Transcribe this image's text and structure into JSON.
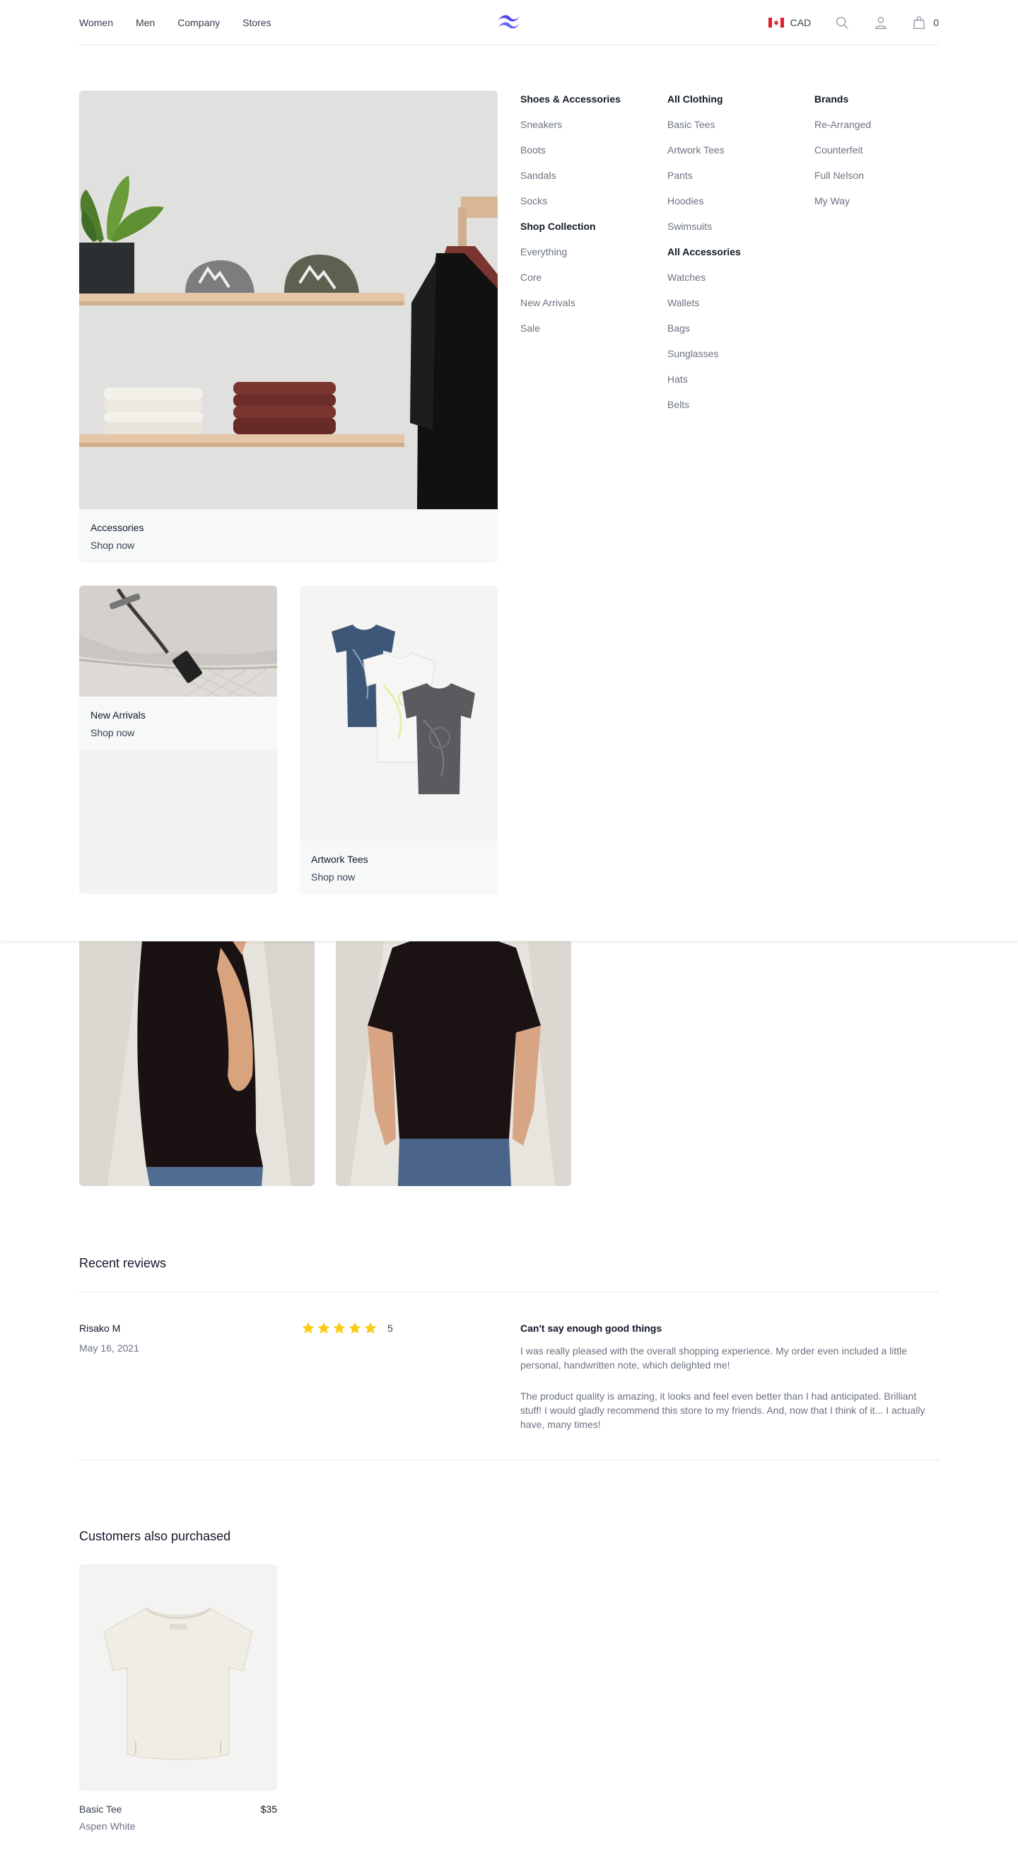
{
  "header": {
    "nav": [
      "Women",
      "Men",
      "Company",
      "Stores"
    ],
    "currency": "CAD",
    "cart_count": "0"
  },
  "flyout": {
    "featured": [
      {
        "title": "Accessories",
        "cta": "Shop now"
      },
      {
        "title": "New Arrivals",
        "cta": "Shop now"
      },
      {
        "title": "Artwork Tees",
        "cta": "Shop now"
      }
    ],
    "columns": {
      "shoes": {
        "heading": "Shoes & Accessories",
        "items": [
          "Sneakers",
          "Boots",
          "Sandals",
          "Socks"
        ]
      },
      "collection": {
        "heading": "Shop Collection",
        "items": [
          "Everything",
          "Core",
          "New Arrivals",
          "Sale"
        ]
      },
      "clothing": {
        "heading": "All Clothing",
        "items": [
          "Basic Tees",
          "Artwork Tees",
          "Pants",
          "Hoodies",
          "Swimsuits"
        ]
      },
      "accessories": {
        "heading": "All Accessories",
        "items": [
          "Watches",
          "Wallets",
          "Bags",
          "Sunglasses",
          "Hats",
          "Belts"
        ]
      },
      "brands": {
        "heading": "Brands",
        "items": [
          "Re-Arranged",
          "Counterfeit",
          "Full Nelson",
          "My Way"
        ]
      }
    }
  },
  "reviews": {
    "title": "Recent reviews",
    "items": [
      {
        "author": "Risako M",
        "date": "May 16, 2021",
        "rating": 5,
        "rating_text": "5",
        "title": "Can't say enough good things",
        "paragraphs": [
          "I was really pleased with the overall shopping experience. My order even included a little personal, handwritten note, which delighted me!",
          "The product quality is amazing, it looks and feel even better than I had anticipated. Brilliant stuff! I would gladly recommend this store to my friends. And, now that I think of it... I actually have, many times!"
        ]
      }
    ]
  },
  "related": {
    "title": "Customers also purchased",
    "items": [
      {
        "name": "Basic Tee",
        "price": "$35",
        "color": "Aspen White"
      }
    ]
  },
  "colors": {
    "accent": "#4f46e5",
    "star": "#facc15",
    "caption_bg": "#f7f9f9"
  }
}
